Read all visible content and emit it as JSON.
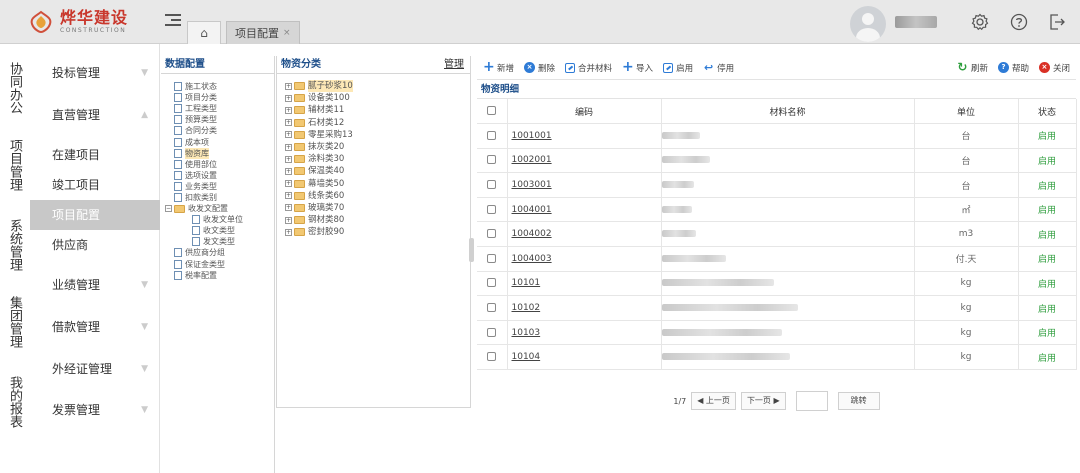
{
  "header": {
    "logo_cn": "烨华建设",
    "logo_en": "CONSTRUCTION",
    "tabs": [
      {
        "label": "项目配置",
        "close": "×"
      }
    ],
    "icons": [
      "menu-icon",
      "home-icon",
      "settings-icon",
      "help-icon",
      "logout-icon"
    ]
  },
  "nav": {
    "groups": [
      {
        "label": "协同办公"
      },
      {
        "label": "项目管理"
      },
      {
        "label": "系统管理"
      },
      {
        "label": "集团管理"
      },
      {
        "label": "我的报表"
      }
    ],
    "items": [
      {
        "label": "投标管理",
        "arrow": "▼"
      },
      {
        "label": "直营管理",
        "arrow": "▲"
      },
      {
        "label": "在建项目"
      },
      {
        "label": "竣工项目"
      },
      {
        "label": "项目配置",
        "active": true
      },
      {
        "label": "供应商"
      },
      {
        "label": "业绩管理",
        "arrow": "▼"
      },
      {
        "label": "借款管理",
        "arrow": "▼"
      },
      {
        "label": "外经证管理",
        "arrow": "▼"
      },
      {
        "label": "发票管理",
        "arrow": "▼"
      }
    ]
  },
  "data_config": {
    "title": "数据配置",
    "items": [
      "施工状态",
      "项目分类",
      "工程类型",
      "预算类型",
      "合同分类",
      "成本项",
      "物资库",
      "使用部位",
      "选项设置",
      "业务类型",
      "扣款类别",
      "收发文配置",
      "收发文单位",
      "收文类型",
      "发文类型",
      "供应商分组",
      "保证金类型",
      "税率配置"
    ]
  },
  "material_category": {
    "title": "物资分类",
    "manage": "管理",
    "items": [
      "腻子砂浆10",
      "设备类100",
      "辅材类11",
      "石材类12",
      "零星采购13",
      "抹灰类20",
      "涂料类30",
      "保温类40",
      "幕墙类50",
      "线条类60",
      "玻璃类70",
      "钢材类80",
      "密封胶90"
    ]
  },
  "toolbar": {
    "add": "新增",
    "delete": "删除",
    "merge": "合并材料",
    "import": "导入",
    "enable": "启用",
    "disable": "停用",
    "refresh": "刷新",
    "help": "帮助",
    "close": "关闭"
  },
  "grid": {
    "title": "物资明细",
    "columns": [
      "编码",
      "材料名称",
      "单位",
      "状态"
    ],
    "rows": [
      {
        "code": "1001001",
        "unit": "台",
        "status": "启用"
      },
      {
        "code": "1002001",
        "unit": "台",
        "status": "启用"
      },
      {
        "code": "1003001",
        "unit": "台",
        "status": "启用"
      },
      {
        "code": "1004001",
        "unit": "㎡",
        "status": "启用"
      },
      {
        "code": "1004002",
        "unit": "m3",
        "status": "启用"
      },
      {
        "code": "1004003",
        "unit": "付.天",
        "status": "启用"
      },
      {
        "code": "10101",
        "unit": "kg",
        "status": "启用"
      },
      {
        "code": "10102",
        "unit": "kg",
        "status": "启用"
      },
      {
        "code": "10103",
        "unit": "kg",
        "status": "启用"
      },
      {
        "code": "10104",
        "unit": "kg",
        "status": "启用"
      }
    ]
  },
  "pager": {
    "page_info": "1/7",
    "prev": "◀ 上一页",
    "next": "下一页 ▶",
    "jump": "跳转"
  },
  "colors": {
    "accent": "#2e7bd6",
    "brand": "#c9372c",
    "enabled": "#2f9e3e",
    "delete": "#2e7bd6",
    "close": "#d93025",
    "refresh": "#2f9e3e",
    "help": "#2e7bd6"
  }
}
